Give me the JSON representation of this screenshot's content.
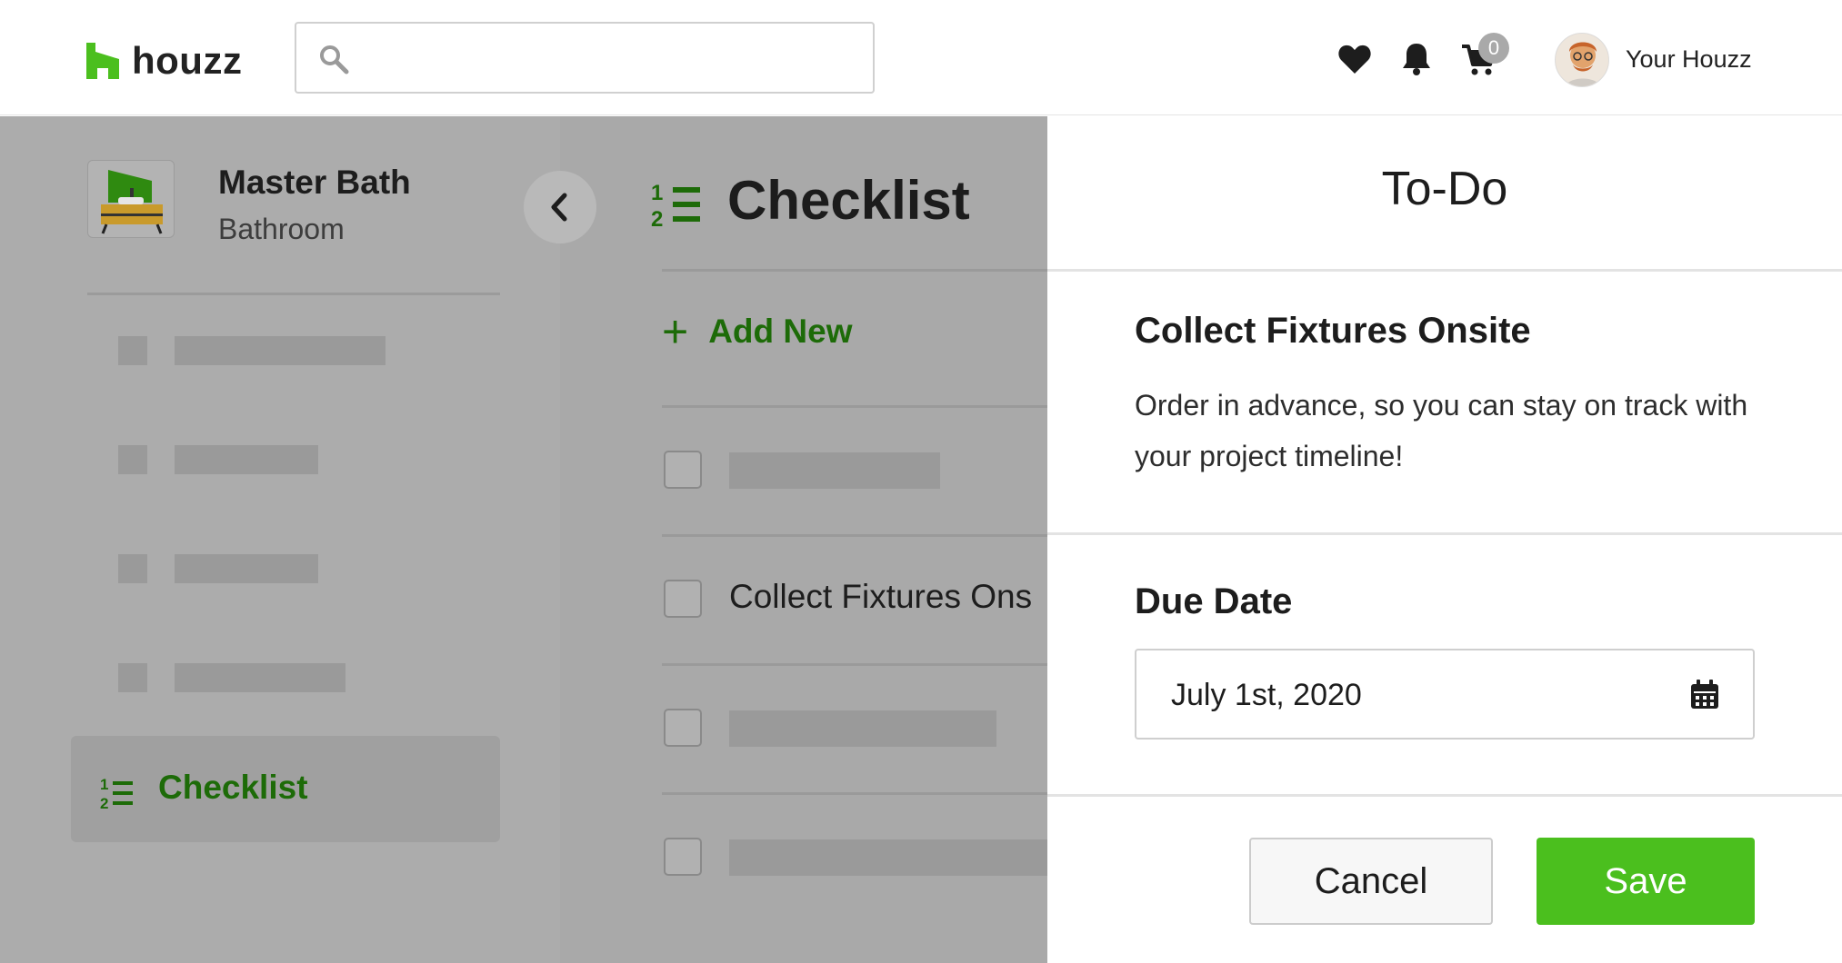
{
  "header": {
    "logo_text": "houzz",
    "search_placeholder": "",
    "cart_count": "0",
    "user_label": "Your Houzz",
    "brand_color": "#4bbf1e"
  },
  "sidebar": {
    "project_title": "Master Bath",
    "project_subtitle": "Bathroom",
    "active_item_label": "Checklist"
  },
  "main": {
    "title": "Checklist",
    "add_new_label": "Add New",
    "items": [
      {
        "text": "",
        "placeholder": true
      },
      {
        "text": "Collect Fixtures Ons",
        "placeholder": false
      },
      {
        "text": "",
        "placeholder": true
      },
      {
        "text": "",
        "placeholder": true
      }
    ]
  },
  "drawer": {
    "title": "To-Do",
    "task_title": "Collect Fixtures Onsite",
    "task_description": "Order in advance, so you can stay on track with your project timeline!",
    "due_date_label": "Due Date",
    "due_date_value": "July 1st, 2020",
    "cancel_label": "Cancel",
    "save_label": "Save"
  }
}
